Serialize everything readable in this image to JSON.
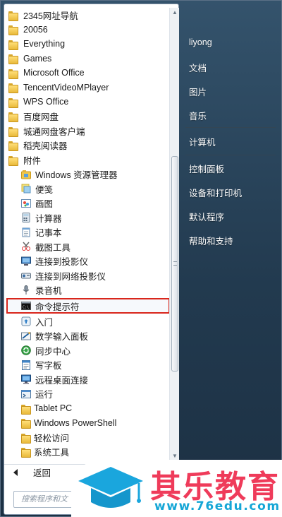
{
  "program_list": {
    "items": [
      {
        "label": "2345网址导航",
        "icon": "folder-icon"
      },
      {
        "label": "20056",
        "icon": "folder-icon"
      },
      {
        "label": "Everything",
        "icon": "folder-icon"
      },
      {
        "label": "Games",
        "icon": "folder-icon"
      },
      {
        "label": "Microsoft Office",
        "icon": "folder-icon"
      },
      {
        "label": "TencentVideoMPlayer",
        "icon": "folder-icon"
      },
      {
        "label": "WPS Office",
        "icon": "folder-icon"
      },
      {
        "label": "百度网盘",
        "icon": "folder-icon"
      },
      {
        "label": "城通网盘客户端",
        "icon": "folder-icon"
      },
      {
        "label": "稻壳阅读器",
        "icon": "folder-icon"
      },
      {
        "label": "附件",
        "icon": "folder-open-icon"
      },
      {
        "label": "Windows 资源管理器",
        "icon": "explorer-icon"
      },
      {
        "label": "便笺",
        "icon": "sticky-notes-icon"
      },
      {
        "label": "画图",
        "icon": "paint-icon"
      },
      {
        "label": "计算器",
        "icon": "calculator-icon"
      },
      {
        "label": "记事本",
        "icon": "notepad-icon"
      },
      {
        "label": "截图工具",
        "icon": "snipping-tool-icon"
      },
      {
        "label": "连接到投影仪",
        "icon": "projector-icon"
      },
      {
        "label": "连接到网络投影仪",
        "icon": "network-projector-icon"
      },
      {
        "label": "录音机",
        "icon": "microphone-icon"
      },
      {
        "label": "命令提示符",
        "icon": "command-prompt-icon"
      },
      {
        "label": "入门",
        "icon": "getting-started-icon"
      },
      {
        "label": "数学输入面板",
        "icon": "math-input-icon"
      },
      {
        "label": "同步中心",
        "icon": "sync-center-icon"
      },
      {
        "label": "写字板",
        "icon": "wordpad-icon"
      },
      {
        "label": "远程桌面连接",
        "icon": "remote-desktop-icon"
      },
      {
        "label": "运行",
        "icon": "run-icon"
      },
      {
        "label": "Tablet PC",
        "icon": "folder-icon"
      },
      {
        "label": "Windows PowerShell",
        "icon": "folder-icon"
      },
      {
        "label": "轻松访问",
        "icon": "folder-icon"
      },
      {
        "label": "系统工具",
        "icon": "folder-icon"
      }
    ]
  },
  "back_label": "返回",
  "search": {
    "placeholder": "搜索程序和文"
  },
  "right_pane": {
    "items": [
      {
        "label": "liyong"
      },
      {
        "label": "文档"
      },
      {
        "label": "图片"
      },
      {
        "label": "音乐"
      },
      {
        "label": "计算机"
      },
      {
        "label": "控制面板"
      },
      {
        "label": "设备和打印机"
      },
      {
        "label": "默认程序"
      },
      {
        "label": "帮助和支持"
      }
    ]
  },
  "watermark": {
    "title": "其乐教育",
    "url": "www.76edu.com"
  },
  "colors": {
    "highlight_border": "#d9261c",
    "watermark_title": "#ef3b5a",
    "watermark_url": "#15a6d6"
  }
}
